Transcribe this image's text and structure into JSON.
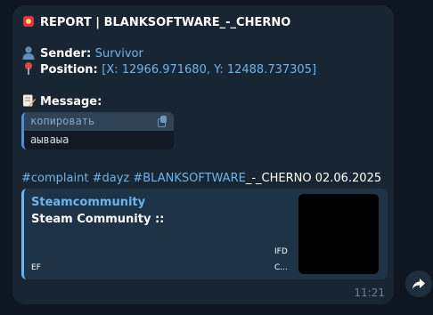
{
  "message": {
    "title": "REPORT | BLANKSOFTWARE_-_CHERNO",
    "sender_label": "Sender:",
    "sender_value": "Survivor",
    "position_label": "Position:",
    "position_value": "[X: 12966.971680, Y: 12488.737305]",
    "message_label": "Message:",
    "code": {
      "header_label": "копировать",
      "content": "аываыа"
    },
    "tags": {
      "t1": "#complaint",
      "t2": "#dayz",
      "t3": "#BLANKSOFTWARE",
      "suffix": "_-_CHERNO 02.06.2025"
    },
    "preview": {
      "site": "Steamcommunity",
      "title": "Steam Community ::",
      "text_ifd": "IFD",
      "text_ef": "EF",
      "text_c": "C..."
    },
    "time": "11:21"
  },
  "icons": {
    "title": "siren-icon",
    "sender": "bust-icon",
    "position": "pin-icon",
    "message": "memo-icon",
    "copy": "copy-icon",
    "share": "share-arrow-icon"
  },
  "colors": {
    "background": "#0e1621",
    "bubble": "#182533",
    "link": "#6cb4ee",
    "text": "#ffffff"
  }
}
